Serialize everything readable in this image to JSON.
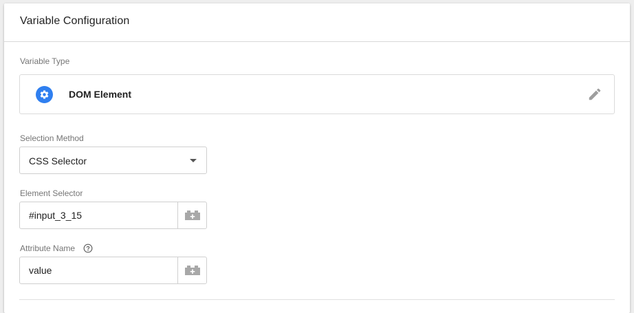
{
  "panel": {
    "title": "Variable Configuration"
  },
  "variable_type": {
    "label": "Variable Type",
    "name": "DOM Element",
    "icon": "gear-icon",
    "icon_color": "#2f7ff0",
    "action_icon": "pencil-icon"
  },
  "selection_method": {
    "label": "Selection Method",
    "value": "CSS Selector"
  },
  "element_selector": {
    "label": "Element Selector",
    "value": "#input_3_15",
    "button_icon": "lego-brick-plus-icon"
  },
  "attribute_name": {
    "label": "Attribute Name",
    "help_icon": "help-circle-icon",
    "value": "value",
    "button_icon": "lego-brick-plus-icon"
  }
}
